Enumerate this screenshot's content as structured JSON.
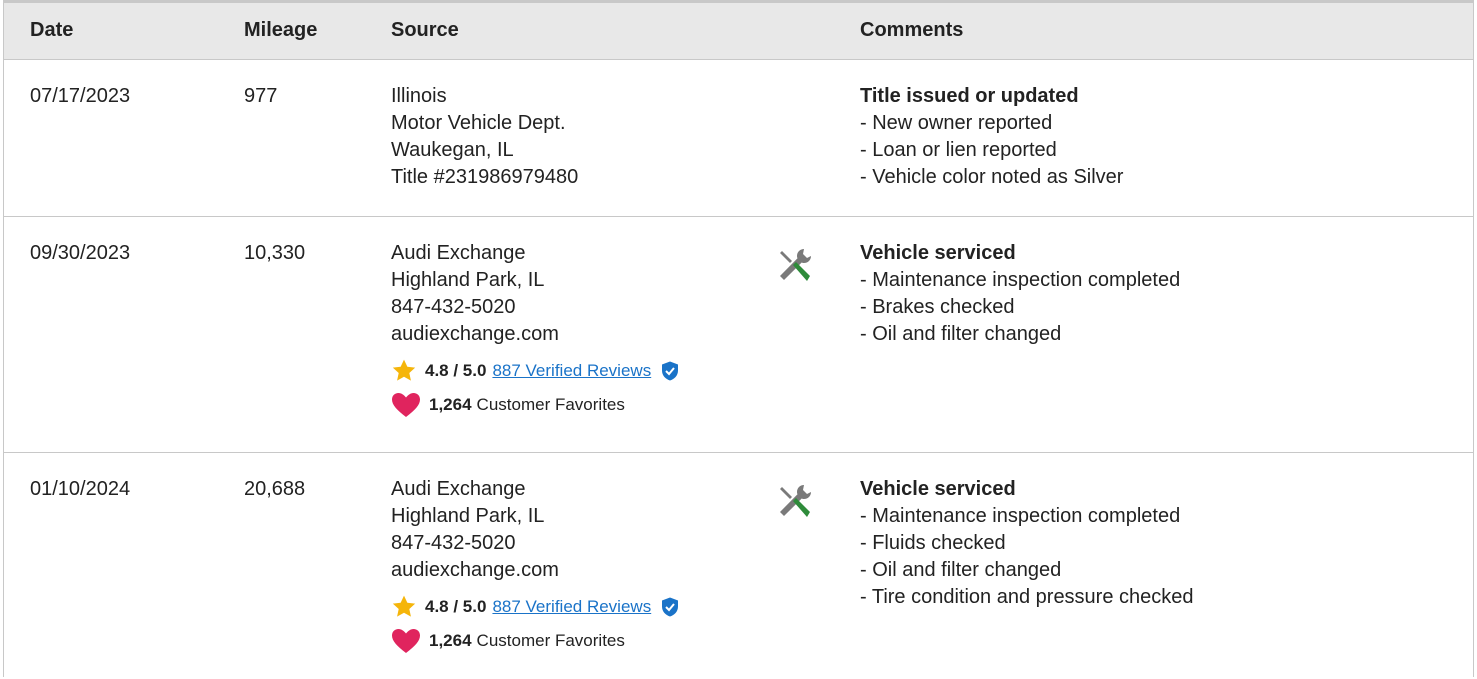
{
  "header": {
    "date": "Date",
    "mileage": "Mileage",
    "source": "Source",
    "comments": "Comments"
  },
  "rows": [
    {
      "date": "07/17/2023",
      "mileage": "977",
      "source": [
        "Illinois",
        "Motor Vehicle Dept.",
        "Waukegan, IL",
        "Title #231986979480"
      ],
      "comment_title": "Title issued or updated",
      "comment_items": [
        "- New owner reported",
        "- Loan or lien reported",
        "- Vehicle color noted as Silver"
      ]
    },
    {
      "date": "09/30/2023",
      "mileage": "10,330",
      "source": [
        "Audi Exchange",
        "Highland Park, IL",
        "847-432-5020",
        "audiexchange.com"
      ],
      "rating": "4.8 / 5.0",
      "reviews_link": "887 Verified Reviews",
      "favorites_count": "1,264",
      "favorites_label": "Customer Favorites",
      "comment_title": "Vehicle serviced",
      "comment_items": [
        "- Maintenance inspection completed",
        "- Brakes checked",
        "- Oil and filter changed"
      ]
    },
    {
      "date": "01/10/2024",
      "mileage": "20,688",
      "source": [
        "Audi Exchange",
        "Highland Park, IL",
        "847-432-5020",
        "audiexchange.com"
      ],
      "rating": "4.8 / 5.0",
      "reviews_link": "887 Verified Reviews",
      "favorites_count": "1,264",
      "favorites_label": "Customer Favorites",
      "comment_title": "Vehicle serviced",
      "comment_items": [
        "- Maintenance inspection completed",
        "- Fluids checked",
        "- Oil and filter changed",
        "- Tire condition and pressure checked"
      ]
    }
  ],
  "icons": {
    "service": "wrench-screwdriver-icon",
    "star": "star-icon",
    "verified": "verified-shield-icon",
    "heart": "heart-icon"
  },
  "colors": {
    "header_bg": "#e8e8e8",
    "link": "#1a73c8",
    "star": "#f5b50a",
    "heart": "#e0245e",
    "shield": "#1a73c8",
    "tool_handle": "#2e8b3a",
    "tool_metal": "#7a7a7a"
  }
}
